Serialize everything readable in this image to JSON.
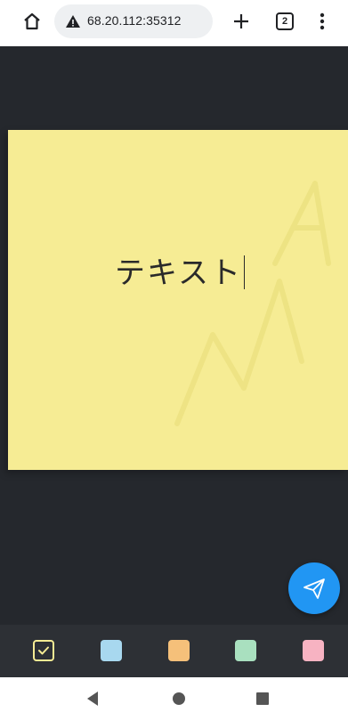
{
  "browser": {
    "url": "68.20.112:35312",
    "tab_count": "2",
    "icons": {
      "home": "home-icon",
      "security_warning": "warning-icon",
      "new_tab": "plus-icon",
      "menu": "more-vert-icon"
    }
  },
  "note": {
    "text": "テキスト",
    "background_color": "#f6ec94",
    "watermark_text": "MA"
  },
  "send_button": {
    "icon": "paper-plane-icon",
    "color": "#2196f3"
  },
  "color_palette": {
    "selected": "#f6ec94",
    "swatches": [
      "#a8d8ef",
      "#f5c07a",
      "#a9e0bf",
      "#f7b3c2"
    ]
  },
  "app_background": "#25282d",
  "nav": {
    "back": "back-icon",
    "home": "home-circle-icon",
    "recents": "recents-square-icon"
  }
}
